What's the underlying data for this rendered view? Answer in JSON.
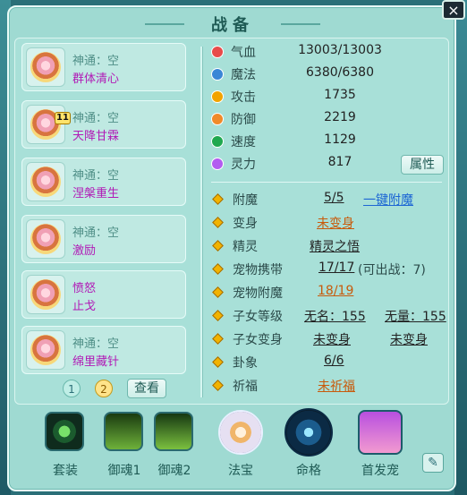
{
  "title": "战备",
  "close_label": "×",
  "shentong_cards": [
    {
      "line1": "神通：空",
      "line2": "群体清心",
      "badge": ""
    },
    {
      "line1": "神通：空",
      "line2": "天降甘霖",
      "badge": "11"
    },
    {
      "line1": "神通：空",
      "line2": "涅槃重生",
      "badge": ""
    },
    {
      "line1": "神通：空",
      "line2": "激励",
      "badge": ""
    },
    {
      "line1": "愤怒",
      "line2": "止戈",
      "badge": ""
    },
    {
      "line1": "神通：空",
      "line2": "绵里藏针",
      "badge": ""
    }
  ],
  "pager": {
    "page1": "1",
    "page2": "2",
    "view_button": "查看"
  },
  "stats": [
    {
      "label": "气血",
      "value": "13003/13003",
      "icon": "heart-icon",
      "color": "#e84a4a"
    },
    {
      "label": "魔法",
      "value": "6380/6380",
      "icon": "mana-icon",
      "color": "#3a86d6"
    },
    {
      "label": "攻击",
      "value": "1735",
      "icon": "attack-icon",
      "color": "#f2a300"
    },
    {
      "label": "防御",
      "value": "2219",
      "icon": "shield-icon",
      "color": "#f08a2a"
    },
    {
      "label": "速度",
      "value": "1129",
      "icon": "speed-icon",
      "color": "#1fa84f"
    },
    {
      "label": "灵力",
      "value": "817",
      "icon": "spirit-icon",
      "color": "#b35cf0"
    }
  ],
  "attr_button": "属性",
  "features": [
    {
      "label": "附魔",
      "v1": "5/5",
      "v2": "一键附魔"
    },
    {
      "label": "变身",
      "v1": "未变身"
    },
    {
      "label": "精灵",
      "v1": "精灵之悟"
    },
    {
      "label": "宠物携带",
      "v1": "17/17",
      "v2": "(可出战：7)"
    },
    {
      "label": "宠物附魔",
      "v1": "18/19"
    },
    {
      "label": "子女等级",
      "v1": "无名：155",
      "v2": "无量：155"
    },
    {
      "label": "子女变身",
      "v1": "未变身",
      "v2": "未变身"
    },
    {
      "label": "卦象",
      "v1": "6/6"
    },
    {
      "label": "祈福",
      "v1": "未祈福"
    }
  ],
  "bottom_tabs": [
    {
      "label": "套装",
      "icon": "suit-icon"
    },
    {
      "label": "御魂1",
      "icon": "yuhun1-icon"
    },
    {
      "label": "御魂2",
      "icon": "yuhun2-icon"
    },
    {
      "label": "法宝",
      "icon": "fabao-icon"
    },
    {
      "label": "命格",
      "icon": "mingge-icon"
    },
    {
      "label": "首发宠",
      "icon": "pet-icon"
    }
  ],
  "edit_icon": "edit-icon"
}
